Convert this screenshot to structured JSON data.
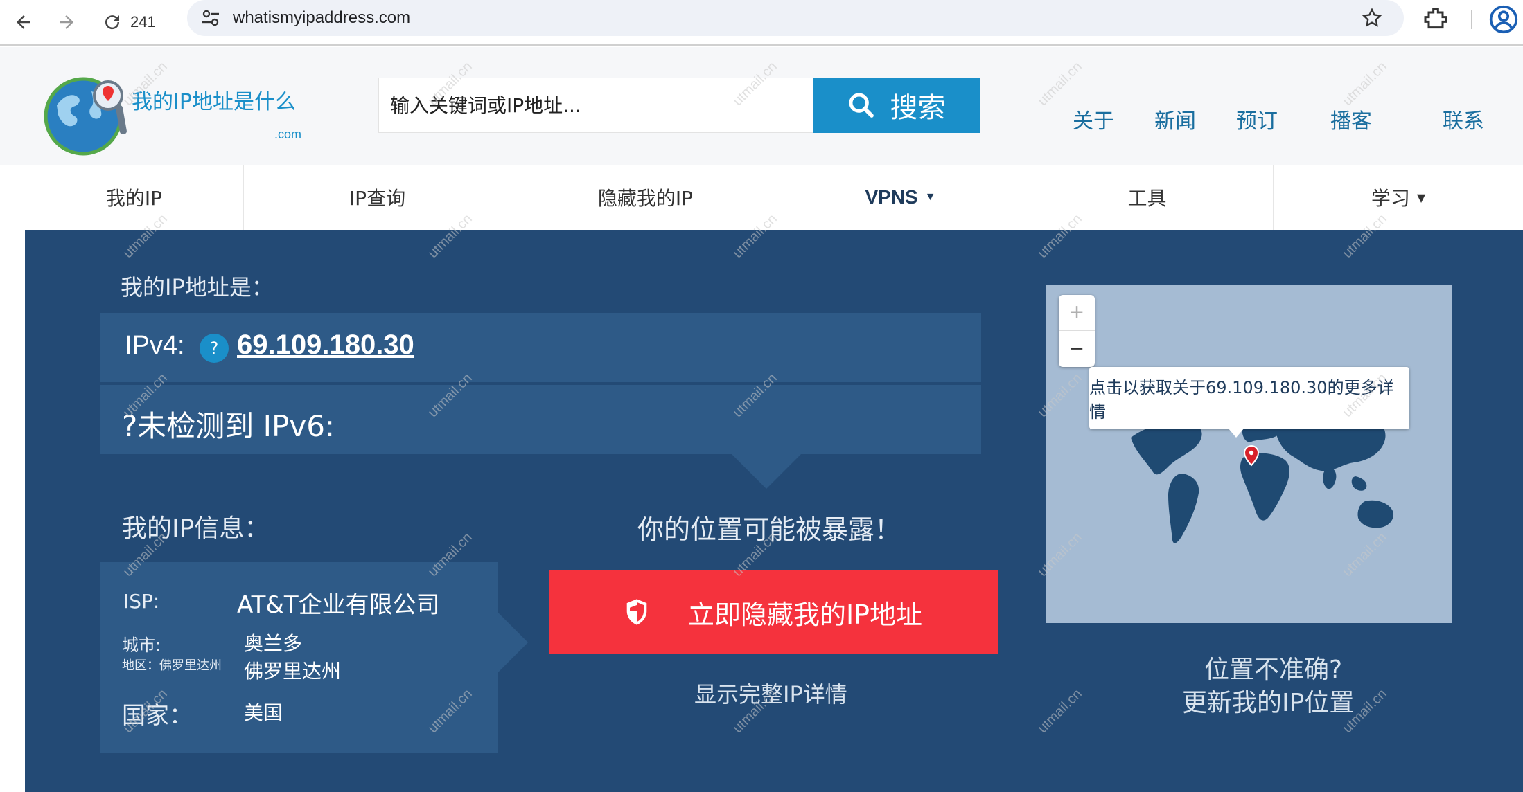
{
  "browser": {
    "tab_count": "241",
    "url": "whatismyipaddress.com"
  },
  "site": {
    "logo_text": "我的IP地址是什么",
    "logo_sub": ".com",
    "search_placeholder": "输入关键词或IP地址...",
    "search_button": "搜索",
    "top_links": [
      "关于",
      "新闻",
      "预订",
      "播客",
      "联系"
    ]
  },
  "nav": [
    {
      "label": "我的IP"
    },
    {
      "label": "IP查询"
    },
    {
      "label": "隐藏我的IP"
    },
    {
      "label": "VPNS",
      "caret": "▼"
    },
    {
      "label": "工具"
    },
    {
      "label": "学习",
      "caret": "▼"
    }
  ],
  "main": {
    "ip_heading": "我的IP地址是：",
    "ipv4_label": "IPv4:",
    "ipv4_help": "?",
    "ipv4_value": "69.109.180.30",
    "ipv6_label": "?未检测到 IPv6:",
    "info_heading": "我的IP信息：",
    "info": {
      "isp_label": "ISP:",
      "isp_value": "AT&T企业有限公司",
      "city_label": "城市:",
      "city_value": "奥兰多",
      "region_label": "地区：佛罗里达州",
      "region_value": "佛罗里达州",
      "country_label": "国家：",
      "country_value": "美国"
    },
    "exposed_text": "你的位置可能被暴露！",
    "hide_button": "立即隐藏我的IP地址",
    "details_link": "显示完整IP详情",
    "map_tooltip": "点击以获取关于69.109.180.30的更多详情",
    "zoom_in": "+",
    "zoom_out": "−",
    "location_wrong": "位置不准确?",
    "update_location": "更新我的IP位置"
  },
  "watermark": "utmail.cn",
  "colors": {
    "brand_blue": "#1a8fc9",
    "panel_bg": "#234a75",
    "panel_row": "#2e5a87",
    "hide_red": "#f5323d",
    "map_ocean": "#a5bbd3",
    "map_land": "#1f4a72"
  }
}
